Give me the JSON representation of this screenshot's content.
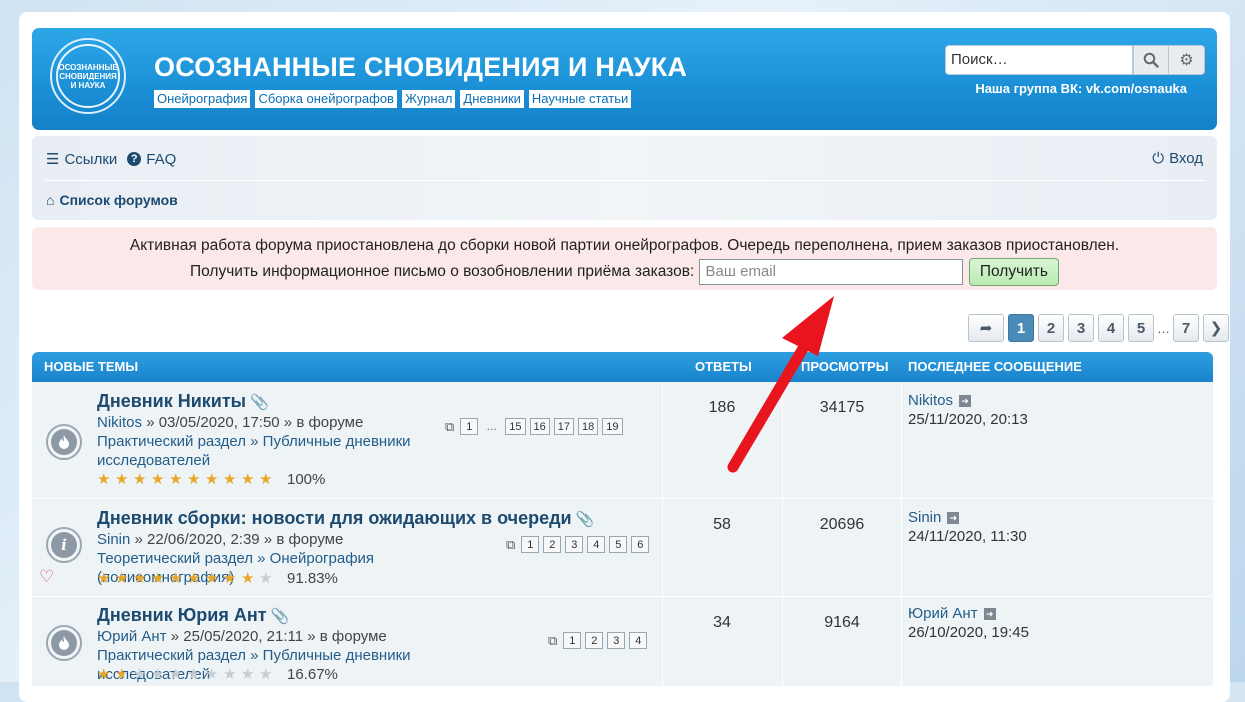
{
  "header": {
    "logo_text": "ОСОЗНАННЫЕ СНОВИДЕНИЯ И НАУКА",
    "title": "ОСОЗНАННЫЕ СНОВИДЕНИЯ И НАУКА",
    "links": [
      "Онейрография",
      "Сборка онейрографов",
      "Журнал",
      "Дневники",
      "Научные статьи"
    ],
    "search_placeholder": "Поиск…",
    "vk_group": "Наша группа ВК: vk.com/osnauka"
  },
  "navbar": {
    "links_label": "Ссылки",
    "faq_label": "FAQ",
    "login_label": "Вход",
    "breadcrumb": "Список форумов"
  },
  "notice": {
    "line1": "Активная работа форума приостановлена до сборки новой партии онейрографов. Очередь переполнена, прием заказов приостановлен.",
    "line2": "Получить информационное письмо о возобновлении приёма заказов:",
    "email_placeholder": "Ваш email",
    "button": "Получить"
  },
  "pagination": {
    "pages": [
      "1",
      "2",
      "3",
      "4",
      "5",
      "7"
    ],
    "ellipsis": "…",
    "active": "1"
  },
  "table": {
    "headers": {
      "topics": "НОВЫЕ ТЕМЫ",
      "replies": "ОТВЕТЫ",
      "views": "ПРОСМОТРЫ",
      "last_post": "ПОСЛЕДНЕЕ СООБЩЕНИЕ"
    },
    "rows": [
      {
        "title": "Дневник Никиты",
        "author": "Nikitos",
        "date": "» 03/05/2020, 17:50 » в форуме",
        "forum_path": "Практический раздел » Публичные дневники исследователей",
        "pages": [
          "1",
          "15",
          "16",
          "17",
          "18",
          "19"
        ],
        "ellipsis": "…",
        "rating": 10,
        "rating_label": "100%",
        "replies": "186",
        "views": "34175",
        "last_user": "Nikitos",
        "last_date": "25/11/2020, 20:13",
        "icon": "fire-icon"
      },
      {
        "title": "Дневник сборки: новости для ожидающих в очереди",
        "author": "Sinin",
        "date": "» 22/06/2020, 2:39 » в форуме",
        "forum_path": "Теоретический раздел » Онейрография (полисомнография)",
        "pages": [
          "1",
          "2",
          "3",
          "4",
          "5",
          "6"
        ],
        "rating": 9.18,
        "rating_label": "91.83%",
        "replies": "58",
        "views": "20696",
        "last_user": "Sinin",
        "last_date": "24/11/2020, 11:30",
        "icon": "info-icon"
      },
      {
        "title": "Дневник Юрия Ант",
        "author": "Юрий Ант",
        "date": "» 25/05/2020, 21:11 » в форуме",
        "forum_path": "Практический раздел » Публичные дневники исследователей",
        "pages": [
          "1",
          "2",
          "3",
          "4"
        ],
        "rating": 1.667,
        "rating_label": "16.67%",
        "replies": "34",
        "views": "9164",
        "last_user": "Юрий Ант",
        "last_date": "26/10/2020, 19:45",
        "icon": "fire-icon"
      }
    ]
  },
  "colors": {
    "header_blue": "#1b8fd6",
    "accent_link": "#1d4a6e",
    "notice_bg": "#fbe9ea",
    "arrow_red": "#e8141e",
    "star_gold": "#e9a62a"
  }
}
